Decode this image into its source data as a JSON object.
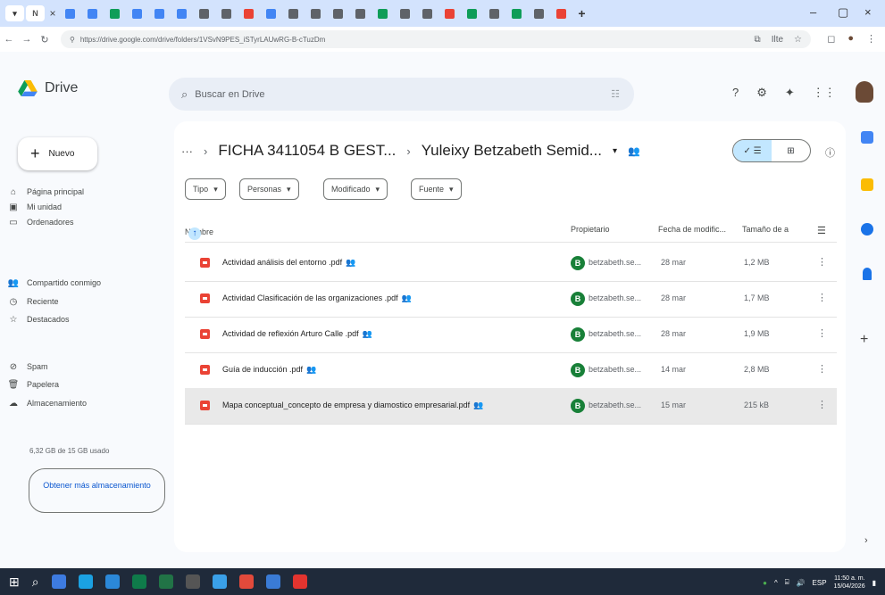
{
  "browser": {
    "url": "https://drive.google.com/drive/folders/1VSvN9PES_iSTyrLAUwRG-B-cTuzDm",
    "tab_favicon_colors": [
      "#4285f4",
      "#4285f4",
      "#0f9d58",
      "#4285f4",
      "#4285f4",
      "#4285f4",
      "#5f6368",
      "#5f6368",
      "#ea4335",
      "#4285f4",
      "#5f6368",
      "#5f6368",
      "#5f6368",
      "#5f6368",
      "#0f9d58",
      "#5f6368",
      "#5f6368",
      "#ea4335",
      "#0f9d58",
      "#5f6368",
      "#0f9d58",
      "#5f6368",
      "#ea4335"
    ],
    "omni_right": "Ilte"
  },
  "header": {
    "app_name": "Drive",
    "search_placeholder": "Buscar en Drive"
  },
  "sidebar": {
    "new_label": "Nuevo",
    "items": [
      {
        "label": "Página principal",
        "icon": "home-icon"
      },
      {
        "label": "Mi unidad",
        "icon": "my-drive-icon"
      },
      {
        "label": "Ordenadores",
        "icon": "computer-icon"
      },
      {
        "label": "Compartido conmigo",
        "icon": "shared-icon"
      },
      {
        "label": "Reciente",
        "icon": "clock-icon"
      },
      {
        "label": "Destacados",
        "icon": "star-icon"
      },
      {
        "label": "Spam",
        "icon": "spam-icon"
      },
      {
        "label": "Papelera",
        "icon": "trash-icon"
      },
      {
        "label": "Almacenamiento",
        "icon": "cloud-icon"
      }
    ],
    "storage_text": "6,32 GB de 15 GB usado",
    "get_more_label": "Obtener más almacenamiento"
  },
  "main": {
    "breadcrumb": {
      "dots": "···",
      "parent": "FICHA 3411054 B GEST...",
      "current": "Yuleixy Betzabeth Semid..."
    },
    "filters": [
      "Tipo",
      "Personas",
      "Modificado",
      "Fuente"
    ],
    "columns": {
      "name": "Nombre",
      "owner": "Propietario",
      "modified": "Fecha de modific...",
      "size": "Tamaño de a"
    },
    "files": [
      {
        "name": "Actividad análisis del entorno .pdf",
        "owner": "betzabeth.se...",
        "owner_initial": "B",
        "date": "28 mar",
        "size": "1,2 MB"
      },
      {
        "name": "Actividad Clasificación de las organizaciones .pdf",
        "owner": "betzabeth.se...",
        "owner_initial": "B",
        "date": "28 mar",
        "size": "1,7 MB"
      },
      {
        "name": "Actividad de reflexión Arturo Calle .pdf",
        "owner": "betzabeth.se...",
        "owner_initial": "B",
        "date": "28 mar",
        "size": "1,9 MB"
      },
      {
        "name": "Guía de inducción .pdf",
        "owner": "betzabeth.se...",
        "owner_initial": "B",
        "date": "14 mar",
        "size": "2,8 MB"
      },
      {
        "name": "Mapa conceptual_concepto de empresa y diamostico empresarial.pdf",
        "owner": "betzabeth.se...",
        "owner_initial": "B",
        "date": "15 mar",
        "size": "215 kB"
      }
    ]
  },
  "taskbar": {
    "icon_colors": [
      "#fff",
      "#fff",
      "#3d7be0",
      "#1ba1e2",
      "#2b88d8",
      "#0f7b4a",
      "#217346",
      "#555",
      "#3aa0e8",
      "#e24a3b",
      "#3a7bd5",
      "#e3342f"
    ],
    "lang": "ESP",
    "time": "11:50 a. m.",
    "date": "15/04/2026"
  }
}
